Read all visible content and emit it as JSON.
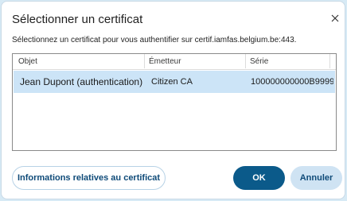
{
  "dialog": {
    "title": "Sélectionner un certificat",
    "prompt": "Sélectionnez un certificat pour vous authentifier sur certif.iamfas.belgium.be:443.",
    "close_icon": "close-icon"
  },
  "table": {
    "columns": {
      "subject": "Objet",
      "issuer": "Émetteur",
      "serial": "Série"
    },
    "rows": [
      {
        "subject": "Jean Dupont (authentication)",
        "issuer": "Citizen CA",
        "serial": "100000000000B9999",
        "selected": true
      }
    ]
  },
  "buttons": {
    "info": "Informations relatives au certificat",
    "ok": "OK",
    "cancel": "Annuler"
  },
  "colors": {
    "accent": "#0b5a8a",
    "selection": "#cce4f7",
    "secondary_button": "#cfe3f3"
  }
}
